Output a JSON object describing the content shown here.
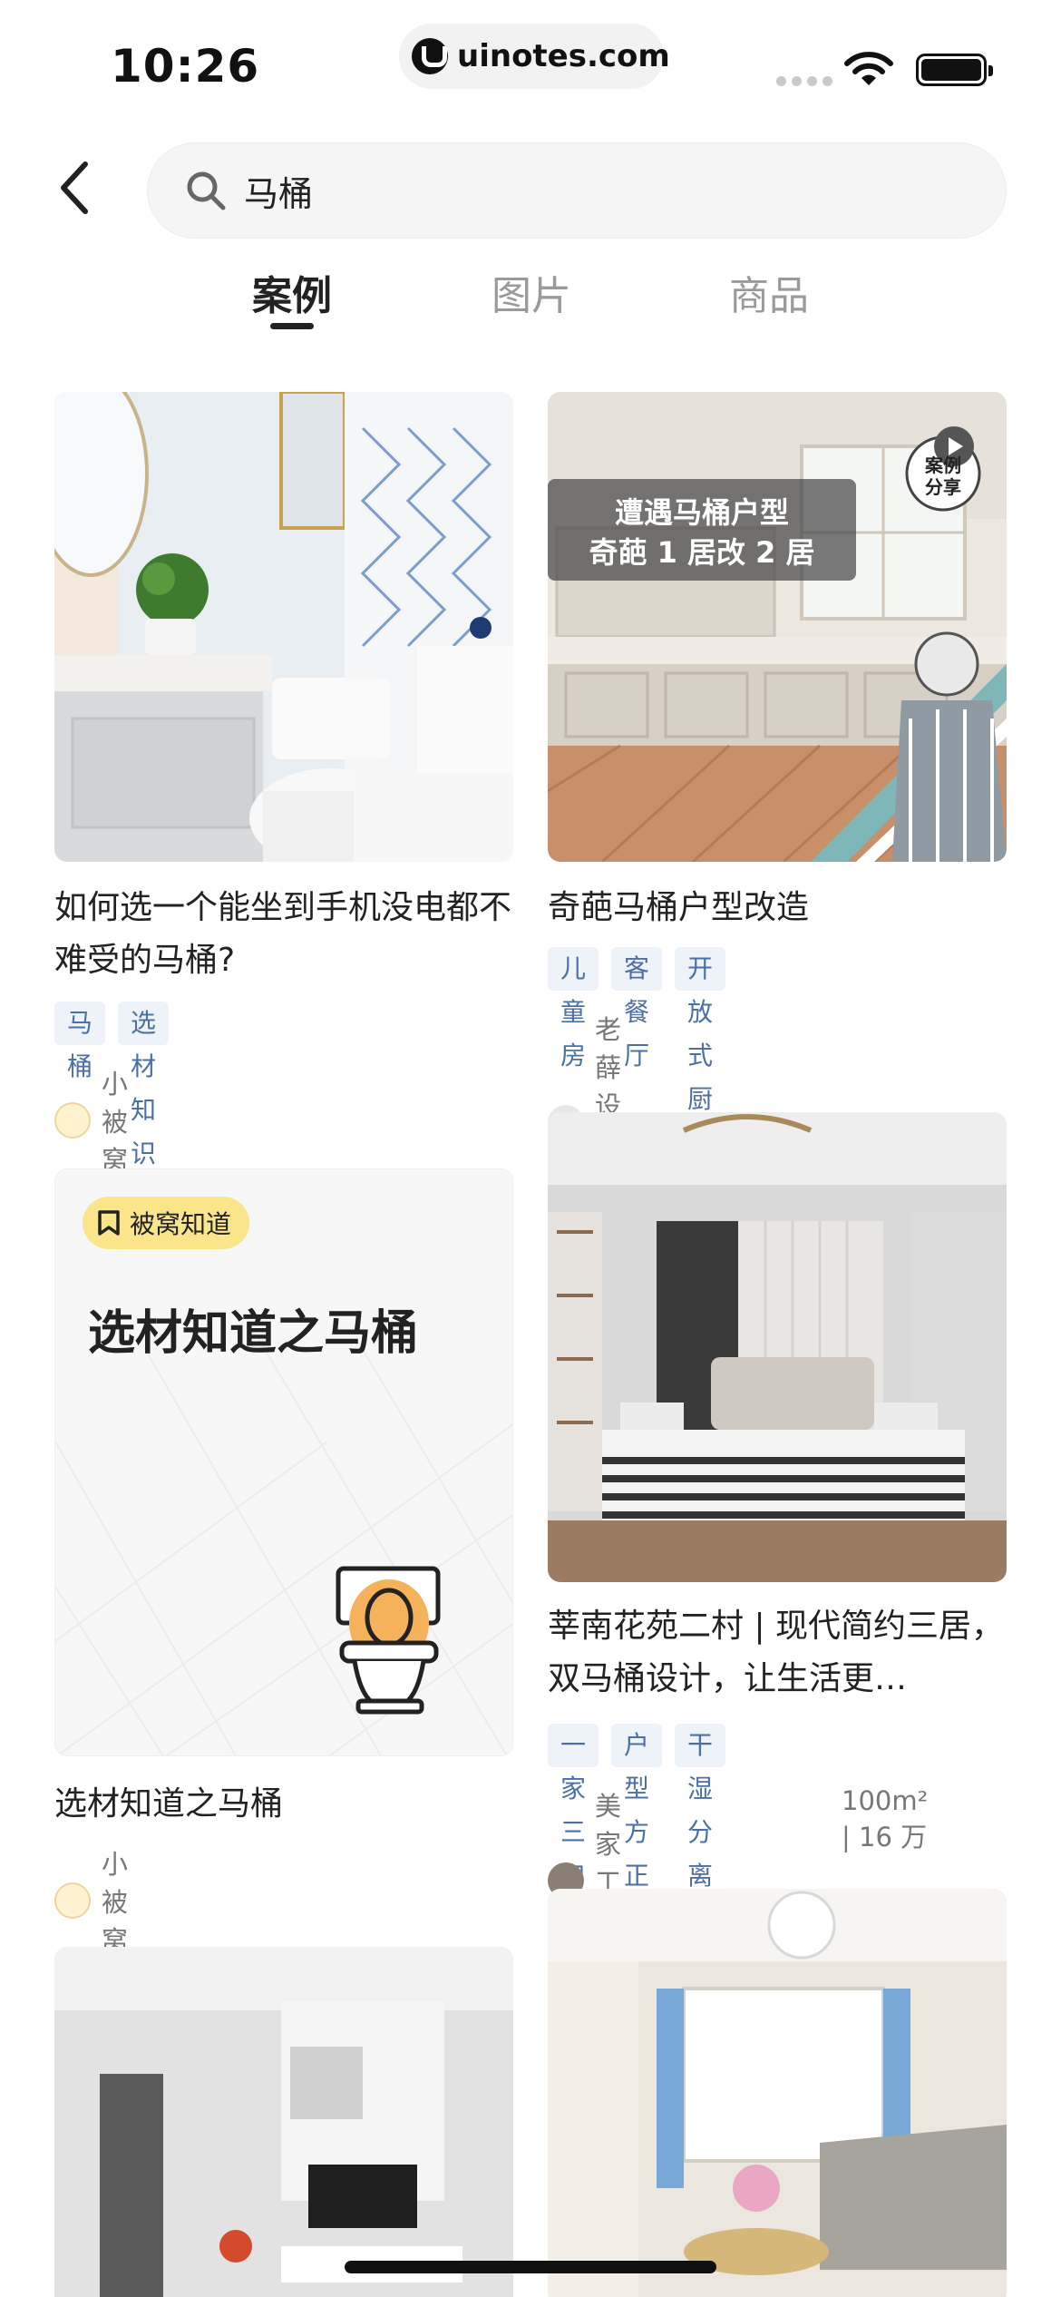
{
  "status_bar": {
    "time": "10:26",
    "url": "uinotes.com"
  },
  "search": {
    "query": "马桶"
  },
  "tabs": [
    {
      "label": "案例",
      "active": true
    },
    {
      "label": "图片",
      "active": false
    },
    {
      "label": "商品",
      "active": false
    }
  ],
  "cards": {
    "c1": {
      "title": "如何选一个能坐到手机没电都不难受的马桶?",
      "tags": [
        "马桶",
        "选材知识"
      ],
      "author": "小被窝"
    },
    "c2": {
      "overlay_line1": "遭遇马桶户型",
      "overlay_line2": "奇葩 1 居改 2 居",
      "badge": "案例分享",
      "title": "奇葩马桶户型改造",
      "tags": [
        "儿童房",
        "客餐厅",
        "开放式厨房"
      ],
      "author": "老薛设计空间"
    },
    "c3": {
      "badge": "被窝知道",
      "headline": "选材知道之马桶",
      "title": "选材知道之马桶",
      "author": "小被窝"
    },
    "c4": {
      "title": "莘南花苑二村 | 现代简约三居，双马桶设计，让生活更…",
      "tags": [
        "一家三口",
        "户型方正",
        "干湿分离"
      ],
      "author": "美家工作室",
      "meta": "100m² | 16 万"
    }
  },
  "colors": {
    "tag_bg": "#eef2f9",
    "tag_text": "#4c6fa5",
    "badge_yellow": "#fbe58b",
    "toilet_orange": "#f5b25b"
  },
  "icons": [
    "back-arrow-icon",
    "search-icon",
    "bookmark-icon",
    "play-icon",
    "wifi-icon",
    "battery-icon",
    "toilet-icon"
  ]
}
